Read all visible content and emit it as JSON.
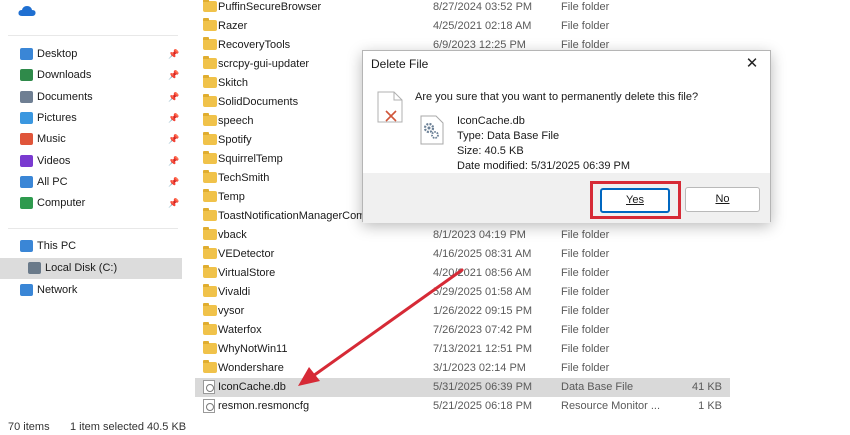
{
  "sidebar": {
    "quick_access": [
      {
        "label": "Desktop",
        "icon": "desktop-icon",
        "color": "#3a86d6"
      },
      {
        "label": "Downloads",
        "icon": "downloads-icon",
        "color": "#2f8a4a"
      },
      {
        "label": "Documents",
        "icon": "documents-icon",
        "color": "#6f7f93"
      },
      {
        "label": "Pictures",
        "icon": "pictures-icon",
        "color": "#3a97e0"
      },
      {
        "label": "Music",
        "icon": "music-icon",
        "color": "#e0553a"
      },
      {
        "label": "Videos",
        "icon": "videos-icon",
        "color": "#7a3ad0"
      },
      {
        "label": "All PC",
        "icon": "pc-icon",
        "color": "#3a86d6"
      },
      {
        "label": "Computer",
        "icon": "computer-icon",
        "color": "#2e9a4e"
      }
    ],
    "tree": [
      {
        "label": "This PC",
        "icon": "this-pc-icon",
        "color": "#3a86d6"
      },
      {
        "label": "Local Disk (C:)",
        "icon": "drive-icon",
        "color": "#6a7a8a"
      },
      {
        "label": "Network",
        "icon": "network-icon",
        "color": "#3a86d6"
      }
    ]
  },
  "files": [
    {
      "name": "PuffinSecureBrowser",
      "date": "8/27/2024 03:52 PM",
      "type": "File folder",
      "size": ""
    },
    {
      "name": "Razer",
      "date": "4/25/2021 02:18 AM",
      "type": "File folder",
      "size": ""
    },
    {
      "name": "RecoveryTools",
      "date": "6/9/2023 12:25 PM",
      "type": "File folder",
      "size": ""
    },
    {
      "name": "scrcpy-gui-updater",
      "date": "",
      "type": "",
      "size": ""
    },
    {
      "name": "Skitch",
      "date": "",
      "type": "",
      "size": ""
    },
    {
      "name": "SolidDocuments",
      "date": "",
      "type": "",
      "size": ""
    },
    {
      "name": "speech",
      "date": "",
      "type": "",
      "size": ""
    },
    {
      "name": "Spotify",
      "date": "",
      "type": "",
      "size": ""
    },
    {
      "name": "SquirrelTemp",
      "date": "",
      "type": "",
      "size": ""
    },
    {
      "name": "TechSmith",
      "date": "",
      "type": "",
      "size": ""
    },
    {
      "name": "Temp",
      "date": "",
      "type": "",
      "size": ""
    },
    {
      "name": "ToastNotificationManagerCom",
      "date": "",
      "type": "",
      "size": ""
    },
    {
      "name": "vback",
      "date": "8/1/2023 04:19 PM",
      "type": "File folder",
      "size": ""
    },
    {
      "name": "VEDetector",
      "date": "4/16/2025 08:31 AM",
      "type": "File folder",
      "size": ""
    },
    {
      "name": "VirtualStore",
      "date": "4/20/2021 08:56 AM",
      "type": "File folder",
      "size": ""
    },
    {
      "name": "Vivaldi",
      "date": "5/29/2025 01:58 AM",
      "type": "File folder",
      "size": ""
    },
    {
      "name": "vysor",
      "date": "1/26/2022 09:15 PM",
      "type": "File folder",
      "size": ""
    },
    {
      "name": "Waterfox",
      "date": "7/26/2023 07:42 PM",
      "type": "File folder",
      "size": ""
    },
    {
      "name": "WhyNotWin11",
      "date": "7/13/2021 12:51 PM",
      "type": "File folder",
      "size": ""
    },
    {
      "name": "Wondershare",
      "date": "3/1/2023 02:14 PM",
      "type": "File folder",
      "size": ""
    },
    {
      "name": "IconCache.db",
      "date": "5/31/2025 06:39 PM",
      "type": "Data Base File",
      "size": "41 KB"
    },
    {
      "name": "resmon.resmoncfg",
      "date": "5/21/2025 06:18 PM",
      "type": "Resource Monitor ...",
      "size": "1 KB"
    }
  ],
  "status": {
    "item_count": "70 items",
    "selection": "1 item selected",
    "selection_size": "40.5 KB"
  },
  "dialog": {
    "title": "Delete File",
    "close_glyph": "✕",
    "question": "Are you sure that you want to permanently delete this file?",
    "file_name": "IconCache.db",
    "file_type": "Type: Data Base File",
    "file_size": "Size: 40.5 KB",
    "file_modified": "Date modified: 5/31/2025 06:39 PM",
    "yes_label": "Yes",
    "no_label": "No"
  },
  "colors": {
    "annotation_red": "#d62a36",
    "focus_blue": "#0067c0",
    "folder_yellow": "#f0c24a"
  }
}
